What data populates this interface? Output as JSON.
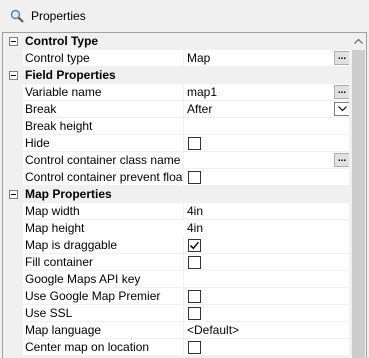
{
  "panel": {
    "title": "Properties",
    "icon": "magnifier-icon"
  },
  "sections": [
    {
      "label": "Control Type",
      "rows": [
        {
          "name": "Control type",
          "value": "Map",
          "editor": "ellipsis"
        }
      ]
    },
    {
      "label": "Field Properties",
      "rows": [
        {
          "name": "Variable name",
          "value": "map1",
          "editor": "ellipsis"
        },
        {
          "name": "Break",
          "value": "After",
          "editor": "dropdown"
        },
        {
          "name": "Break height",
          "value": ""
        },
        {
          "name": "Hide",
          "checked": false
        },
        {
          "name": "Control container class name",
          "value": "",
          "editor": "ellipsis"
        },
        {
          "name": "Control container prevent float",
          "checked": false
        }
      ]
    },
    {
      "label": "Map Properties",
      "rows": [
        {
          "name": "Map width",
          "value": "4in"
        },
        {
          "name": "Map height",
          "value": "4in",
          "highlighted": true
        },
        {
          "name": "Map is draggable",
          "checked": true
        },
        {
          "name": "Fill container",
          "checked": false
        },
        {
          "name": "Google Maps API key",
          "value": ""
        },
        {
          "name": "Use Google Map Premier",
          "checked": false
        },
        {
          "name": "Use SSL",
          "checked": false
        },
        {
          "name": "Map language",
          "value": "<Default>"
        },
        {
          "name": "Center map on location",
          "checked": false
        }
      ]
    }
  ],
  "colors": {
    "grid_line": "#f0f0f0",
    "category_bg": "#f0f0f0",
    "value_bg": "#ffffff",
    "scroll_thumb": "#cdcdcd"
  }
}
